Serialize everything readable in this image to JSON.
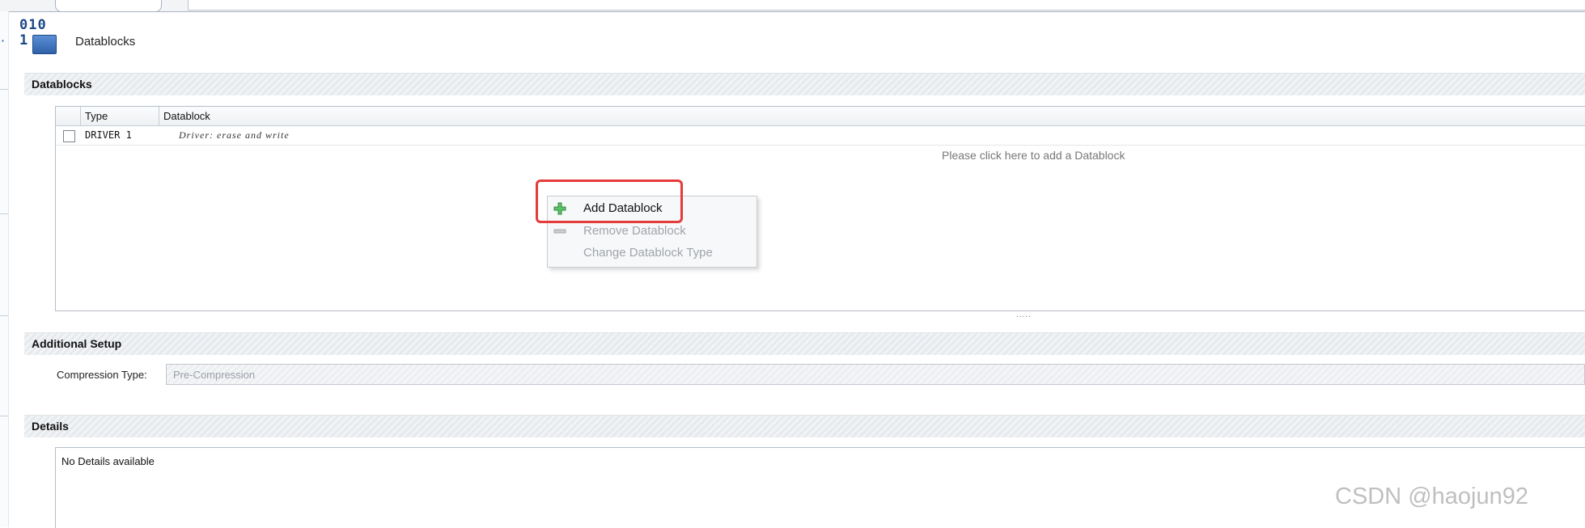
{
  "header": {
    "icon_digits": "010\n1",
    "title": "Datablocks"
  },
  "sections": {
    "datablocks": "Datablocks",
    "additional_setup": "Additional Setup",
    "details": "Details"
  },
  "grid": {
    "columns": [
      "Type",
      "Datablock"
    ],
    "rows": [
      {
        "checked": false,
        "type": "DRIVER 1",
        "datablock": "Driver: erase and write"
      }
    ],
    "add_hint": "Please click here to add a Datablock",
    "resize_grip": "....."
  },
  "context_menu": {
    "items": [
      {
        "label": "Add Datablock",
        "icon": "green-plus-icon",
        "enabled": true
      },
      {
        "label": "Remove Datablock",
        "icon": "minus-icon",
        "enabled": false
      },
      {
        "label": "Change Datablock Type",
        "icon": "",
        "enabled": false
      }
    ],
    "highlight_color": "#e53b3b"
  },
  "setup": {
    "compression_label": "Compression Type:",
    "compression_value": "Pre-Compression"
  },
  "details": {
    "text": "No Details available"
  },
  "watermark": "CSDN @haojun92"
}
